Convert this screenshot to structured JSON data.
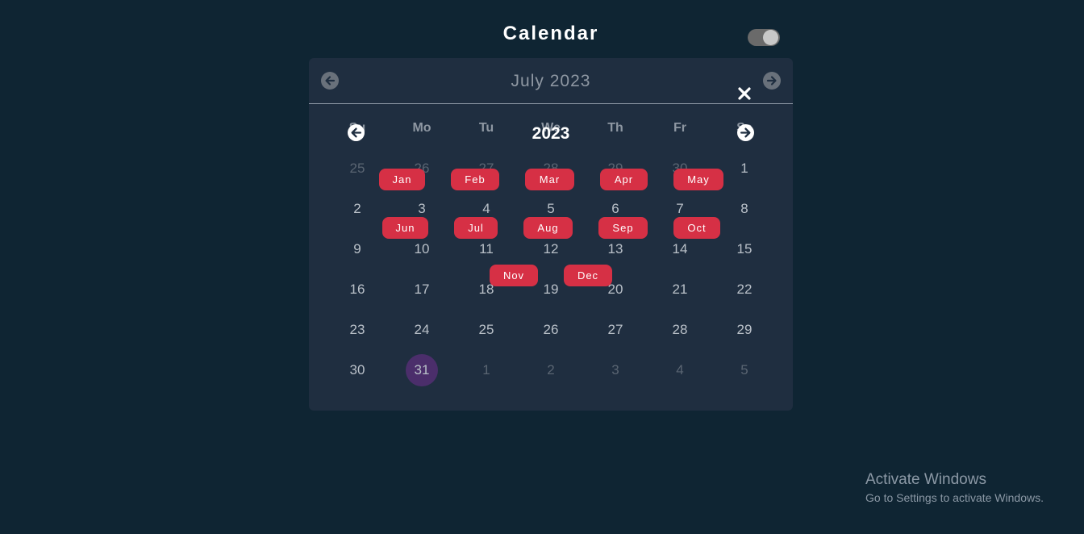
{
  "app": {
    "title": "Calendar"
  },
  "theme_toggle": {
    "state": "on"
  },
  "calendar": {
    "month_label": "July 2023",
    "weekdays": [
      "Su",
      "Mo",
      "Tu",
      "We",
      "Th",
      "Fr",
      "Sa"
    ],
    "weeks": [
      [
        "25",
        "26",
        "27",
        "28",
        "29",
        "30",
        "1"
      ],
      [
        "2",
        "3",
        "4",
        "5",
        "6",
        "7",
        "8"
      ],
      [
        "9",
        "10",
        "11",
        "12",
        "13",
        "14",
        "15"
      ],
      [
        "16",
        "17",
        "18",
        "19",
        "20",
        "21",
        "22"
      ],
      [
        "23",
        "24",
        "25",
        "26",
        "27",
        "28",
        "29"
      ],
      [
        "30",
        "31",
        "1",
        "2",
        "3",
        "4",
        "5"
      ]
    ],
    "selected_day": "31"
  },
  "year_picker": {
    "year": "2023",
    "months": [
      "Jan",
      "Feb",
      "Mar",
      "Apr",
      "May",
      "Jun",
      "Jul",
      "Aug",
      "Sep",
      "Oct",
      "Nov",
      "Dec"
    ]
  },
  "colors": {
    "background": "#0f2533",
    "card": "#1f2e40",
    "month_pill": "#d63045",
    "today": "#4b2e6b"
  },
  "watermark": {
    "title": "Activate Windows",
    "subtitle": "Go to Settings to activate Windows."
  }
}
